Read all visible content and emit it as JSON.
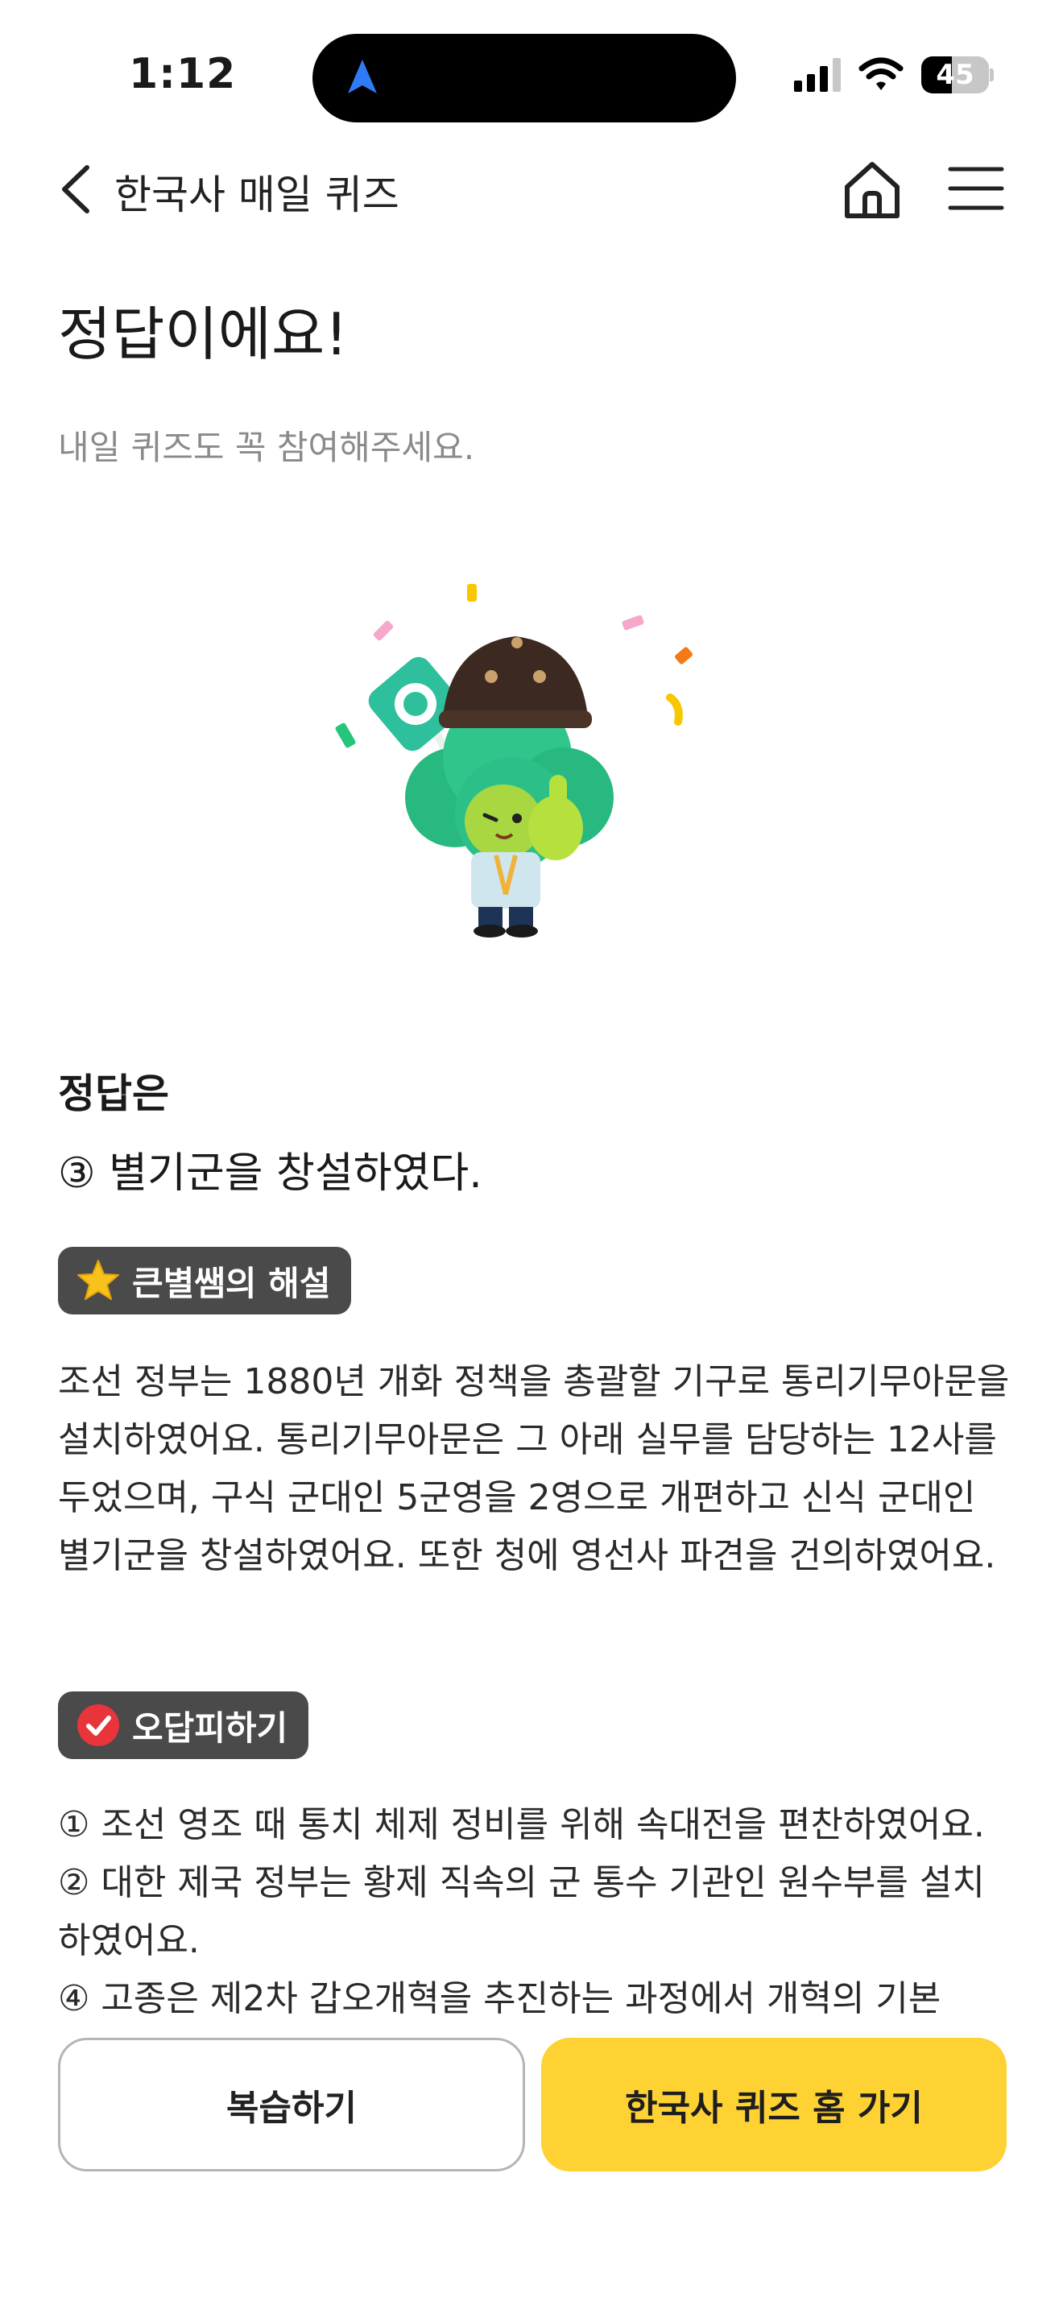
{
  "status_bar": {
    "time": "1:12",
    "battery": "45",
    "battery_level": 0.45,
    "icons": [
      "navigation-arrow-icon",
      "cellular-signal-icon",
      "wifi-icon",
      "battery-icon"
    ]
  },
  "header": {
    "title": "한국사 매일 퀴즈",
    "icons": [
      "back-chevron-icon",
      "home-icon",
      "hamburger-menu-icon"
    ]
  },
  "result": {
    "title": "정답이에요!",
    "subtitle": "내일 퀴즈도 꼭 참여해주세요."
  },
  "answer": {
    "label": "정답은",
    "text": "③ 별기군을 창설하였다."
  },
  "explanation": {
    "badge": "큰별쌤의 해설",
    "text": "조선 정부는 1880년 개화 정책을 총괄할 기구로 통리기무아문을 설치하였어요. 통리기무아문은 그 아래 실무를 담당하는 12사를 두었으며, 구식 군대인 5군영을 2영으로 개편하고 신식 군대인 별기군을 창설하였어요. 또한 청에 영선사 파견을 건의하였어요."
  },
  "wrong_answers": {
    "badge": "오답피하기",
    "items": [
      "① 조선 영조 때 통치 체제 정비를 위해 속대전을 편찬하였어요.",
      "② 대한 제국 정부는 황제 직속의 군 통수 기관인 원수부를 설치하였어요.",
      "④ 고종은 제2차 갑오개혁을 추진하는 과정에서 개혁의 기본"
    ]
  },
  "buttons": {
    "review": "복습하기",
    "home": "한국사 퀴즈 홈 가기"
  },
  "colors": {
    "accent_yellow": "#fed232",
    "badge_bg": "#4a4a4a",
    "check_red": "#e8343b",
    "star_yellow": "#f8c21c"
  }
}
